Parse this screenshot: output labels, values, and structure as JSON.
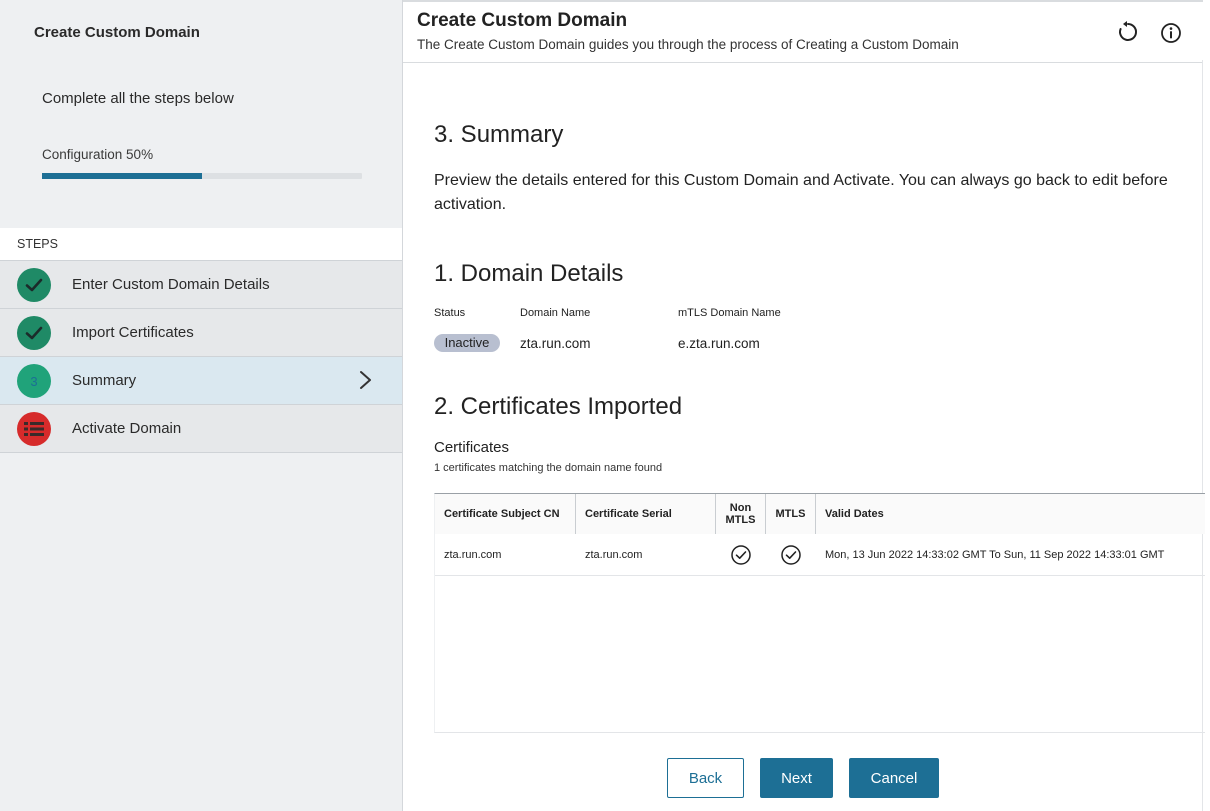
{
  "sidebar": {
    "title": "Create Custom Domain",
    "subtitle": "Complete all the steps below",
    "progress_label": "Configuration 50%",
    "progress_percent": 50,
    "steps_header": "STEPS",
    "steps": [
      {
        "label": "Enter Custom Domain Details",
        "status": "done",
        "icon": "check-icon"
      },
      {
        "label": "Import Certificates",
        "status": "done",
        "icon": "check-icon"
      },
      {
        "label": "Summary",
        "status": "current",
        "number": "3"
      },
      {
        "label": "Activate Domain",
        "status": "blocked",
        "icon": "list-icon"
      }
    ]
  },
  "header": {
    "title": "Create Custom Domain",
    "subtitle": "The Create Custom Domain guides you through the process of Creating a Custom Domain",
    "icons": [
      "refresh-icon",
      "info-icon"
    ]
  },
  "summary": {
    "title": "3. Summary",
    "description": "Preview the details entered for this Custom Domain and Activate. You can always go back to edit before activation."
  },
  "domain_details": {
    "title": "1. Domain Details",
    "labels": {
      "status": "Status",
      "domain_name": "Domain Name",
      "mtls_domain_name": "mTLS Domain Name"
    },
    "values": {
      "status": "Inactive",
      "domain_name": "zta.run.com",
      "mtls_domain_name": "e.zta.run.com"
    }
  },
  "certificates": {
    "title": "2. Certificates Imported",
    "label": "Certificates",
    "count_text": "1 certificates matching the domain name found",
    "columns": [
      "Certificate Subject CN",
      "Certificate Serial",
      "Non MTLS",
      "MTLS",
      "Valid Dates"
    ],
    "rows": [
      {
        "subject_cn": "zta.run.com",
        "serial": "zta.run.com",
        "non_mtls": true,
        "mtls": true,
        "valid_dates": "Mon, 13 Jun 2022 14:33:02 GMT To Sun, 11 Sep 2022 14:33:01 GMT"
      }
    ]
  },
  "buttons": {
    "back": "Back",
    "next": "Next",
    "cancel": "Cancel"
  },
  "colors": {
    "accent": "#1d6f95",
    "done": "#1f8a66",
    "blocked": "#d62b2b",
    "badge": "#b8bfd0"
  }
}
